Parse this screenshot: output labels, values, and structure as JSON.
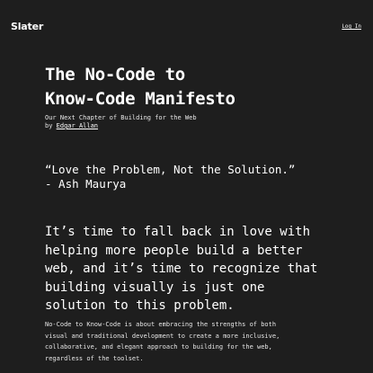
{
  "header": {
    "brand": "Slater",
    "login_label": "Log In"
  },
  "article": {
    "title_lines": [
      "The No-Code to",
      "Know-Code Manifesto"
    ],
    "subtitle": "Our Next Chapter of Building for the Web",
    "byline_prefix": "by ",
    "author": "Edgar Allan",
    "quote_lines": [
      "“Love the Problem, Not the Solution.”",
      "- Ash Maurya"
    ],
    "lead_lines": [
      "It’s time to fall back in love with",
      "helping more people build a better",
      "web, and it’s time to recognize that",
      "building visually is just one",
      "solution to this problem."
    ],
    "body_lines": [
      "No-Code to Know-Code is about embracing the strengths of both",
      "visual and traditional development to create a more inclusive,",
      "collaborative, and elegant approach to building for the web,",
      "regardless of the toolset."
    ]
  }
}
